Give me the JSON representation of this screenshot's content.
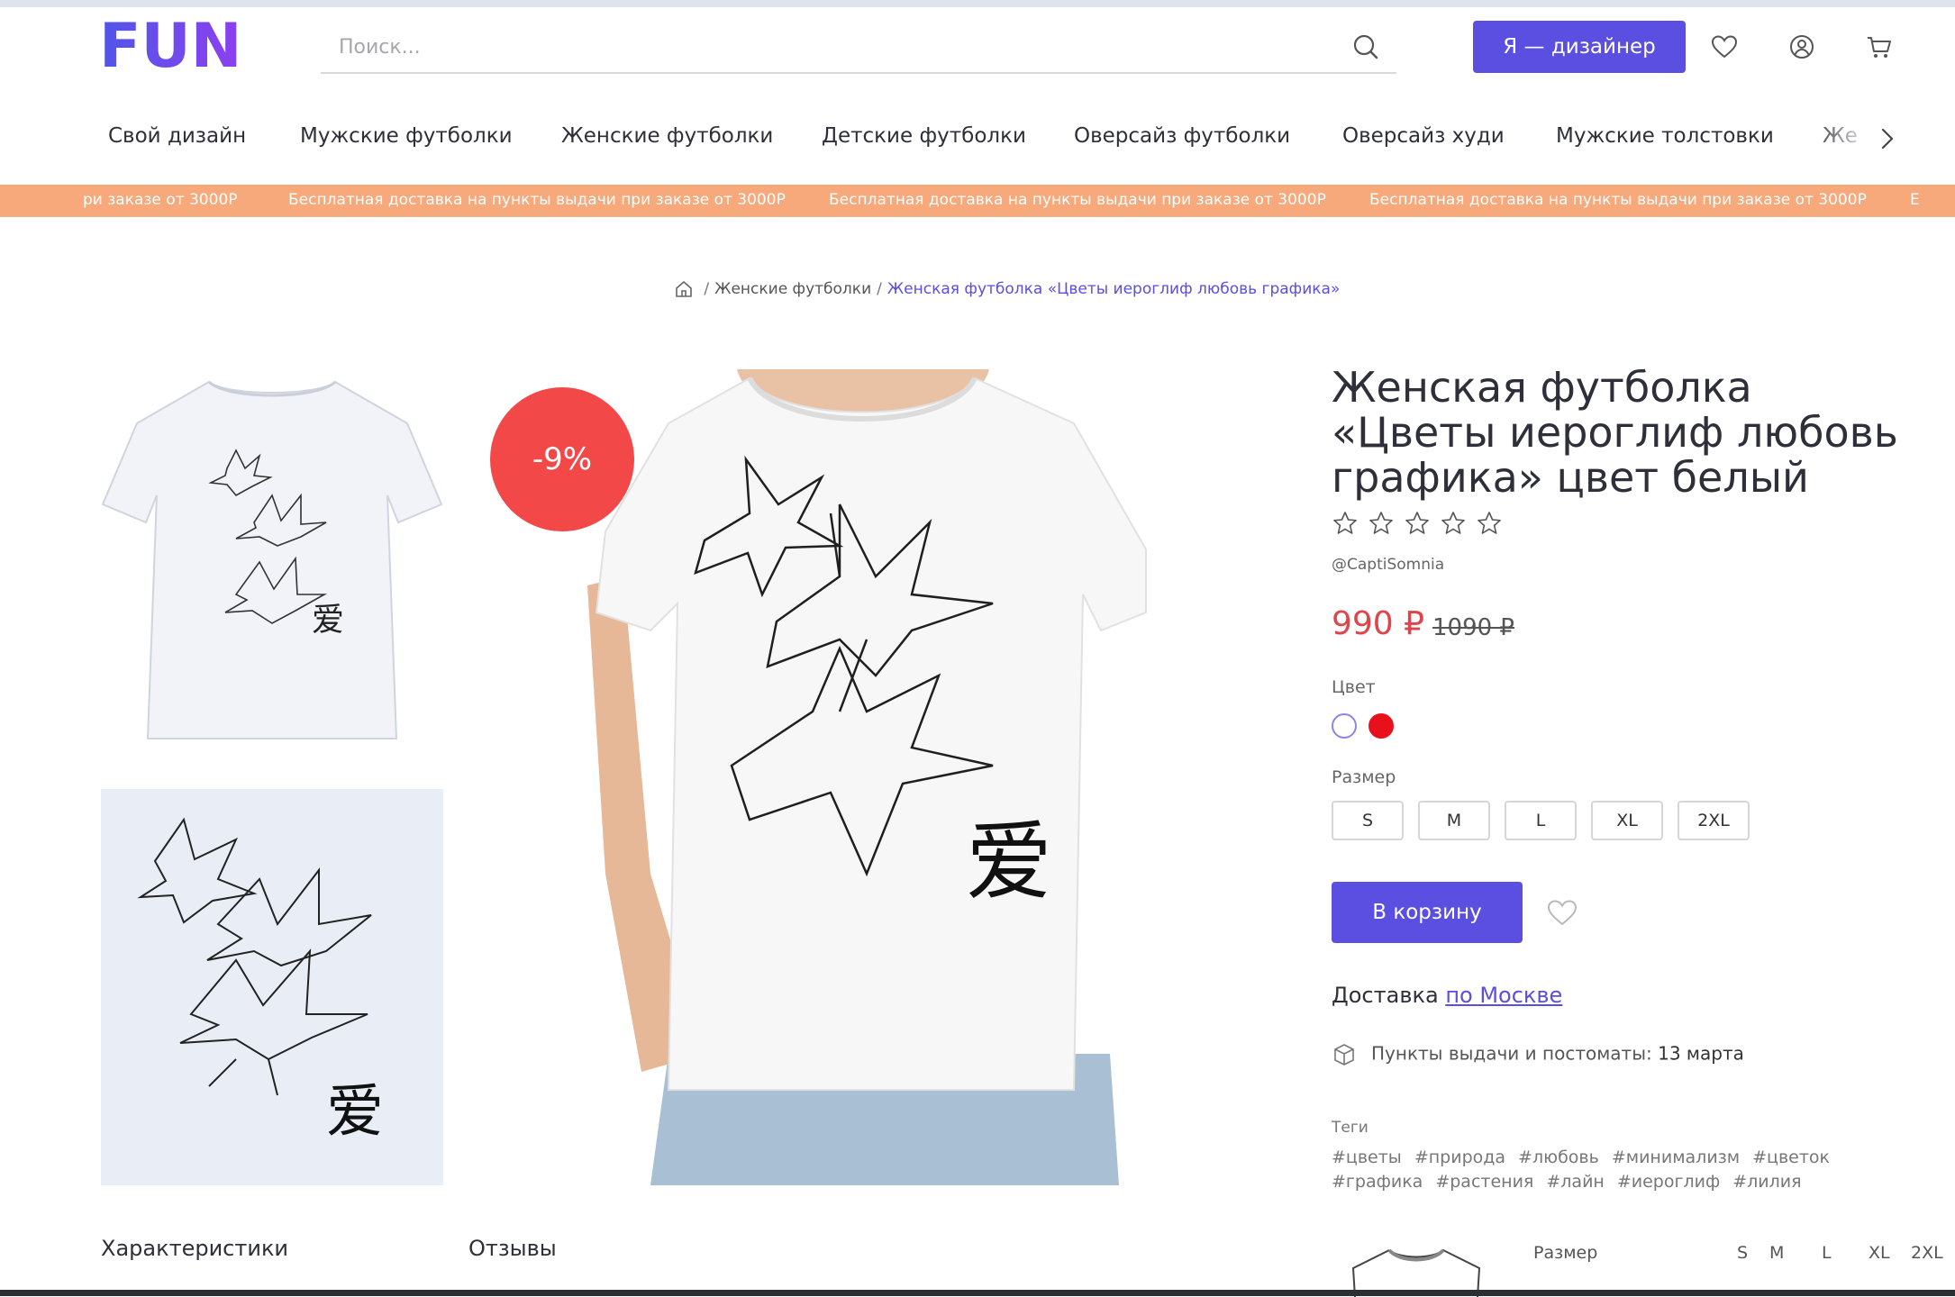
{
  "header": {
    "logo_text": "FUN",
    "search_placeholder": "Поиск...",
    "designer_button": "Я — дизайнер",
    "icons": [
      "search-icon",
      "heart-icon",
      "user-icon",
      "cart-icon"
    ]
  },
  "nav": {
    "items": [
      "Свой дизайн",
      "Мужские футболки",
      "Женские футболки",
      "Детские футболки",
      "Оверсайз футболки",
      "Оверсайз худи",
      "Мужские толстовки",
      "Же"
    ]
  },
  "promo": {
    "first_partial": "ри заказе от 3000Р",
    "text": "Бесплатная доставка на пункты выдачи при заказе от 3000Р",
    "last_partial": "Е"
  },
  "breadcrumb": {
    "category": "Женские футболки",
    "current": "Женская футболка «Цветы иероглиф любовь графика»"
  },
  "product": {
    "discount": "-9%",
    "title_lines": [
      "Женская футболка",
      "«Цветы иероглиф любовь",
      "графика» цвет белый"
    ],
    "rating": 0,
    "rating_max": 5,
    "author": "@CaptiSomnia",
    "price": "990 ₽",
    "old_price": "1090 ₽",
    "color_label": "Цвет",
    "colors": [
      "#ffffff",
      "#e8101a"
    ],
    "size_label": "Размер",
    "sizes": [
      "S",
      "M",
      "L",
      "XL",
      "2XL"
    ],
    "cart_button": "В корзину",
    "delivery_label": "Доставка",
    "delivery_link": "по Москве",
    "pickup_text": "Пункты выдачи и постоматы:",
    "pickup_date": "13 марта",
    "tags_title": "Теги",
    "tags": [
      "#цветы",
      "#природа",
      "#любовь",
      "#минимализм",
      "#цветок",
      "#графика",
      "#растения",
      "#лайн",
      "#иероглиф",
      "#лилия"
    ],
    "hieroglyph": "爱"
  },
  "bottom": {
    "tab_specs": "Характеристики",
    "tab_reviews": "Отзывы",
    "size_table_label": "Размер",
    "size_table_sizes": [
      "S",
      "M",
      "L",
      "XL",
      "2XL"
    ]
  }
}
